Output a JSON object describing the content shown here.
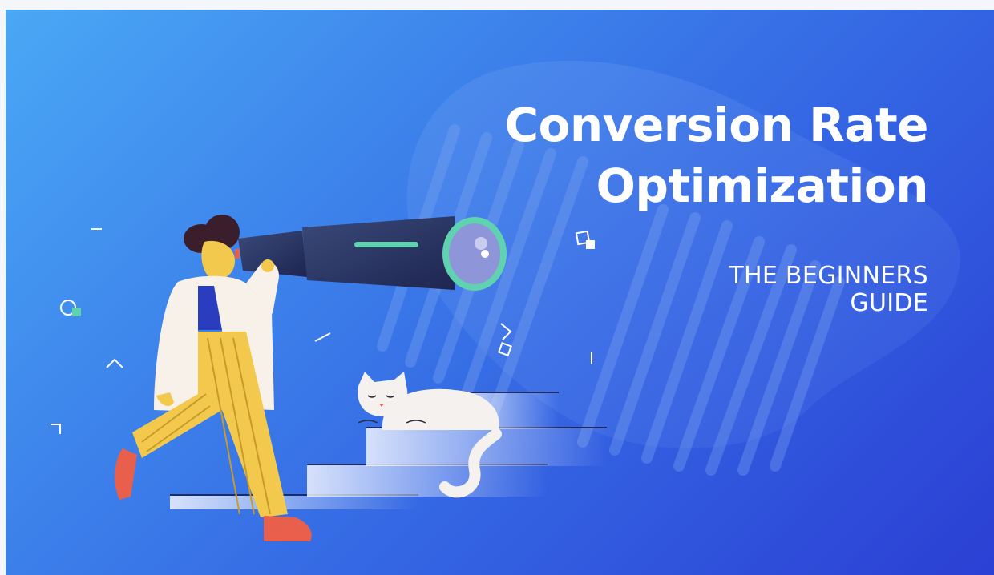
{
  "hero": {
    "title_line1": "Conversion Rate",
    "title_line2": "Optimization",
    "subtitle_line1": "THE BEGINNERS",
    "subtitle_line2": "GUIDE"
  },
  "colors": {
    "gradient_start": "#4aa8f5",
    "gradient_end": "#2b3fd4",
    "title_text": "#ffffff",
    "accent_teal": "#5fd3b0",
    "pants_yellow": "#f2c94c",
    "coat_white": "#f7f1ea",
    "shoe_red": "#e8604c",
    "hair_dark": "#3a1e2b"
  },
  "icons": [
    "person-with-telescope-illustration",
    "telescope-icon",
    "cat-icon",
    "stairs-illustration",
    "confetti-shapes"
  ]
}
